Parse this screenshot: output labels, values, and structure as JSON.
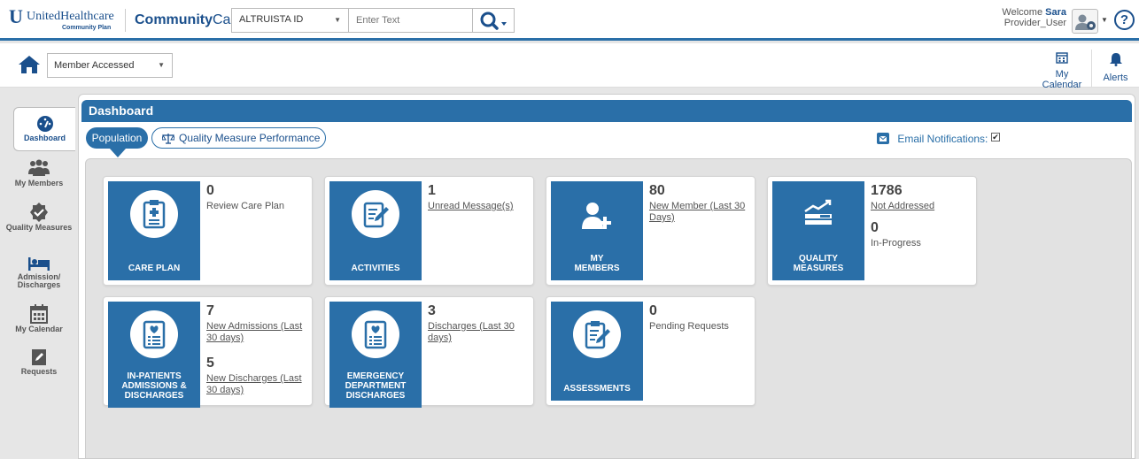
{
  "header": {
    "logo_name": "UnitedHealthcare",
    "logo_sub": "Community Plan",
    "brand_bold": "Community",
    "brand_rest": "Care",
    "search_type": "ALTRUISTA ID",
    "search_placeholder": "Enter Text",
    "welcome": "Welcome",
    "user_first": "Sara",
    "user_role": "Provider_User"
  },
  "subbar": {
    "member_select": "Member Accessed",
    "calendar": "My Calendar",
    "alerts": "Alerts"
  },
  "sidebar": {
    "items": [
      {
        "label": "Dashboard"
      },
      {
        "label": "My Members"
      },
      {
        "label": "Quality Measures"
      },
      {
        "label": "Admission/ Discharges"
      },
      {
        "label": "My Calendar"
      },
      {
        "label": "Requests"
      }
    ]
  },
  "dashboard": {
    "title": "Dashboard",
    "tab_population": "Population",
    "tab_quality": "Quality Measure Performance",
    "email_notifications": "Email Notifications:"
  },
  "cards": {
    "care_plan": {
      "title": "CARE PLAN",
      "n1": "0",
      "l1": "Review Care Plan"
    },
    "activities": {
      "title": "ACTIVITIES",
      "n1": "1",
      "l1": "Unread Message(s)"
    },
    "my_members": {
      "title1": "MY",
      "title2": "MEMBERS",
      "n1": "80",
      "l1": "New Member (Last 30 Days)"
    },
    "quality": {
      "title1": "QUALITY",
      "title2": "MEASURES",
      "n1": "1786",
      "l1": "Not Addressed",
      "n2": "0",
      "l2": "In-Progress"
    },
    "inpatients": {
      "title1": "IN-PATIENTS",
      "title2": "ADMISSIONS &",
      "title3": "DISCHARGES",
      "n1": "7",
      "l1": "New Admissions (Last 30 days)",
      "n2": "5",
      "l2": "New Discharges (Last 30 days)"
    },
    "emergency": {
      "title1": "EMERGENCY",
      "title2": "DEPARTMENT",
      "title3": "DISCHARGES",
      "n1": "3",
      "l1": "Discharges (Last 30 days)"
    },
    "assessments": {
      "title": "ASSESSMENTS",
      "n1": "0",
      "l1": "Pending Requests"
    }
  },
  "colors": {
    "primary": "#2a6fa8",
    "brand": "#1a4f8c"
  }
}
